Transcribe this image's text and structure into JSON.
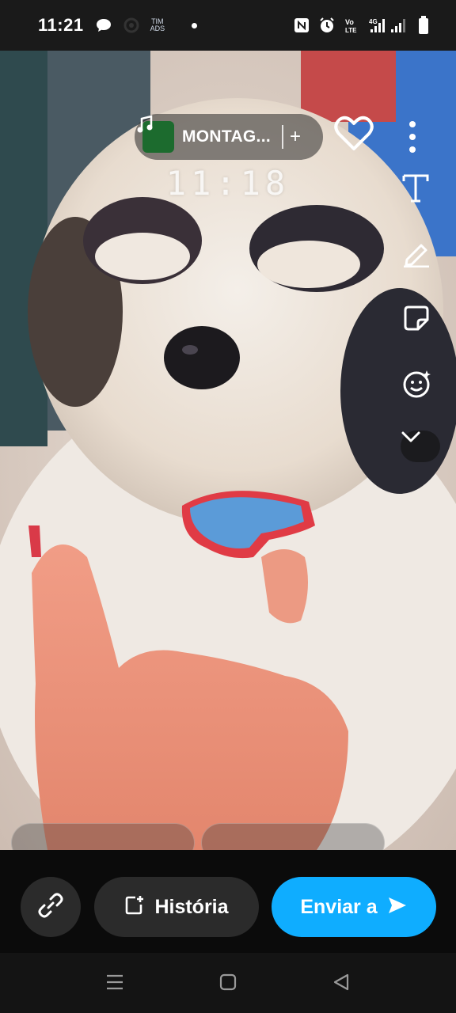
{
  "status_bar": {
    "time": "11:21",
    "carrier_line1": "TIM",
    "carrier_line2": "ADS",
    "network_type": "4G",
    "icons": [
      "chat-bubble-icon",
      "app-icon",
      "nfc-icon",
      "alarm-icon",
      "volte-icon",
      "signal-icon",
      "battery-icon"
    ]
  },
  "photo_overlay": {
    "music_title": "MONTAG...",
    "music_add": "+",
    "clock_sticker": "11:18",
    "tools": [
      "heart-icon",
      "more-icon",
      "text-icon",
      "pencil-icon",
      "sticker-icon",
      "emoji-icon",
      "chevron-down-icon"
    ]
  },
  "actions": {
    "link_icon": "link-icon",
    "story_label": "História",
    "send_label": "Enviar a"
  },
  "colors": {
    "send_button": "#0fadff",
    "action_bar": "#0b0b0b",
    "button_dark": "#2b2b2b"
  },
  "nav_bar": {
    "icons": [
      "menu-icon",
      "home-icon",
      "back-icon"
    ]
  }
}
